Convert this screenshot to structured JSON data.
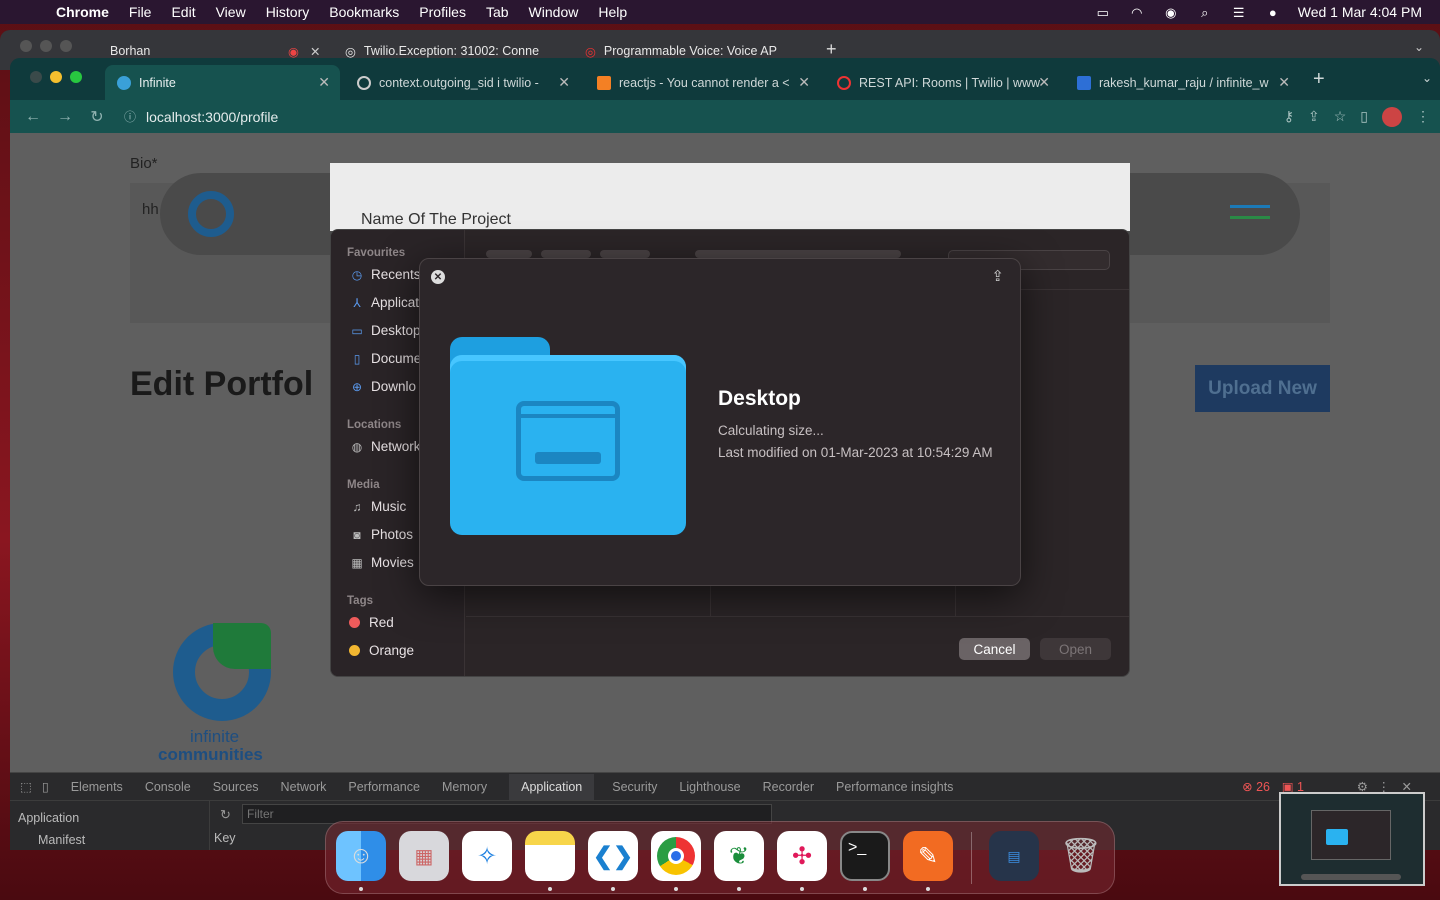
{
  "menubar": {
    "items": [
      "Chrome",
      "File",
      "Edit",
      "View",
      "History",
      "Bookmarks",
      "Profiles",
      "Tab",
      "Window",
      "Help"
    ],
    "clock": "Wed 1 Mar  4:04 PM"
  },
  "back_window": {
    "tabs": [
      "Borhan",
      "Twilio.Exception: 31002: Conne",
      "Programmable Voice: Voice AP"
    ]
  },
  "front_window": {
    "tabs": [
      "Infinite",
      "context.outgoing_sid i twilio - ",
      "reactjs - You cannot render a <",
      "REST API: Rooms | Twilio | www",
      "rakesh_kumar_raju / infinite_w"
    ],
    "url": "localhost:3000/profile"
  },
  "page": {
    "bio_label": "Bio*",
    "bio_value": "hh",
    "heading": "Edit Portfol",
    "upload_button": "Upload New",
    "project_label": "Name Of The Project",
    "logo_line1": "infinite",
    "logo_line2": "communities"
  },
  "file_dialog": {
    "favourites_label": "Favourites",
    "favourites": [
      "Recents",
      "Applicat",
      "Desktop",
      "Docume",
      "Downlo"
    ],
    "locations_label": "Locations",
    "locations": [
      "Network"
    ],
    "media_label": "Media",
    "media": [
      "Music",
      "Photos",
      "Movies"
    ],
    "tags_label": "Tags",
    "tags": [
      {
        "name": "Red",
        "color": "#ee5b5b"
      },
      {
        "name": "Orange",
        "color": "#f2b731"
      }
    ],
    "cancel": "Cancel",
    "open": "Open",
    "location_popup": "Desktop"
  },
  "quicklook": {
    "title": "Desktop",
    "size": "Calculating size...",
    "modified": "Last modified on 01-Mar-2023 at 10:54:29 AM"
  },
  "devtools": {
    "tabs": [
      "Elements",
      "Console",
      "Sources",
      "Network",
      "Performance",
      "Memory",
      "Application",
      "Security",
      "Lighthouse",
      "Recorder",
      "Performance insights"
    ],
    "active_tab": "Application",
    "side_title": "Application",
    "side_item": "Manifest",
    "filter_placeholder": "Filter",
    "key_header": "Key",
    "error_count": "26",
    "issue_count": "1"
  },
  "colors": {
    "accent": "#0f3a3c",
    "folder": "#2ab2f0",
    "upload": "#1f4d8a"
  }
}
